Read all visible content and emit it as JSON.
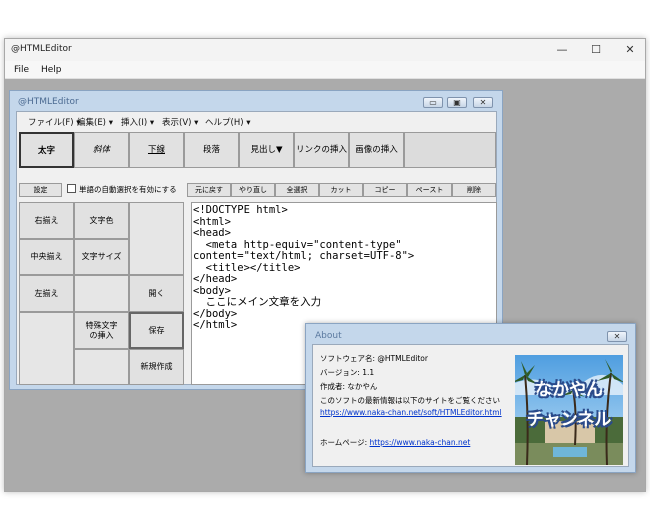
{
  "outer_window": {
    "title": "@HTMLEditor",
    "controls": {
      "minimize": "—",
      "maximize": "☐",
      "close": "✕"
    },
    "menu": [
      "File",
      "Help"
    ]
  },
  "inner_window": {
    "title": "@HTMLEditor",
    "menu": [
      "ファイル(F) ▾",
      "編集(E) ▾",
      "挿入(I) ▾",
      "表示(V) ▾",
      "ヘルプ(H) ▾"
    ],
    "toolbar": {
      "bold": "太字",
      "italic": "斜体",
      "underline": "下線",
      "paragraph": "段落",
      "heading": "見出し▼",
      "insert_link": "リンクの挿入",
      "insert_image": "画像の挿入"
    },
    "settings_label": "設定",
    "auto_select_label": "単語の自動選択を有効にする",
    "edit_buttons": [
      "元に戻す",
      "やり直し",
      "全選択",
      "カット",
      "コピー",
      "ペースト",
      "削除"
    ],
    "side_buttons": {
      "align_right": "右揃え",
      "text_color": "文字色",
      "align_center": "中央揃え",
      "text_size": "文字サイズ",
      "align_left": "左揃え",
      "open": "開く",
      "special_char": "特殊文字の挿入",
      "save": "保存",
      "new": "新規作成"
    },
    "editor_text": "<!DOCTYPE html>\n<html>\n<head>\n  <meta http-equiv=\"content-type\"\ncontent=\"text/html; charset=UTF-8\">\n  <title></title>\n</head>\n<body>\n  ここにメイン文章を入力\n</body>\n</html>"
  },
  "about_dialog": {
    "title": "About",
    "software_name": "ソフトウェア名: @HTMLEditor",
    "version": "バージョン: 1.1",
    "author": "作成者: なかやん",
    "update_info": "このソフトの最新情報は以下のサイトをご覧ください",
    "update_url": "https://www.naka-chan.net/soft/HTMLEditor.html",
    "homepage_label": "ホームページ: ",
    "homepage_url": "https://www.naka-chan.net",
    "image_text_1": "なかやん",
    "image_text_2": "チャンネル"
  },
  "colors": {
    "inner_frame": "#c4d7eb",
    "link": "#0033cc",
    "desktop": "#ababab"
  }
}
